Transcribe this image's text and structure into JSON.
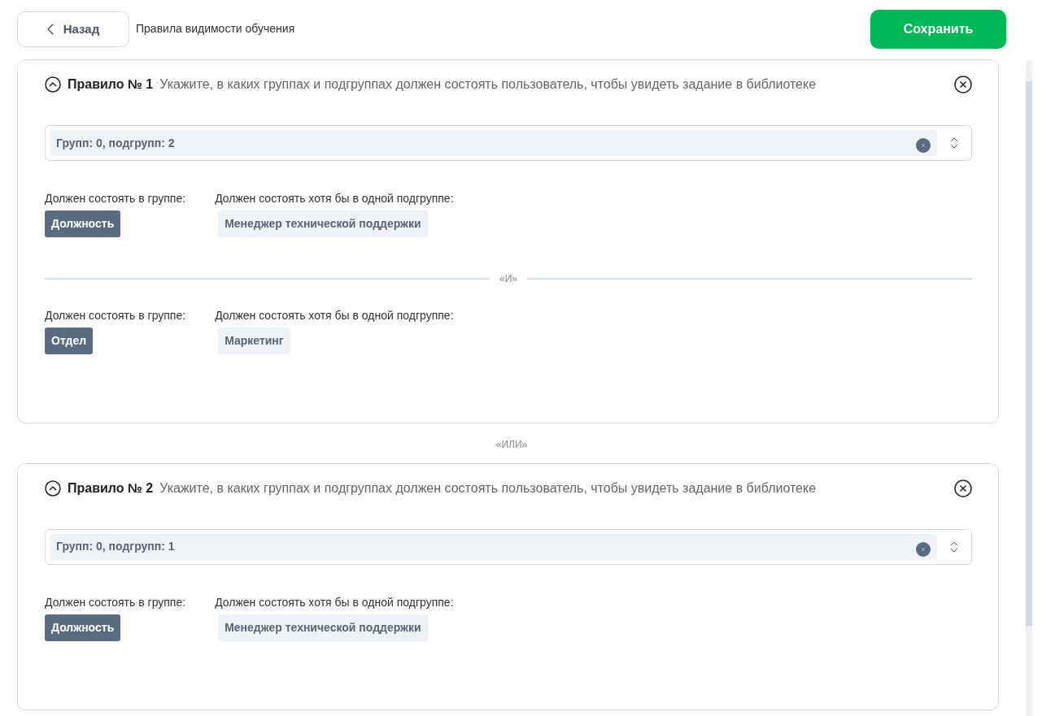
{
  "header": {
    "back_label": "Назад",
    "page_title": "Правила видимости обучения",
    "save_label": "Сохранить"
  },
  "rules": [
    {
      "expanded": true,
      "title": "Правило № 1",
      "hint": "Укажите, в каких группах и подгруппах должен состоять пользователь, чтобы увидеть задание в библиотеке",
      "select_value": "Групп: 0, подгрупп: 2",
      "conditions": [
        {
          "group_label": "Должен состоять в группе:",
          "group": "Должность",
          "subgroup_label": "Должен состоять хотя бы в одной подгруппе:",
          "subgroups": [
            "Менеджер технической поддержки"
          ]
        },
        {
          "separator": "«И»",
          "group_label": "Должен состоять в группе:",
          "group": "Отдел",
          "subgroup_label": "Должен состоять хотя бы в одной подгруппе:",
          "subgroups": [
            "Маркетинг"
          ]
        }
      ]
    },
    {
      "separator": "«ИЛИ»",
      "expanded": true,
      "title": "Правило № 2",
      "hint": "Укажите, в каких группах и подгруппах должен состоять пользователь, чтобы увидеть задание в библиотеке",
      "select_value": "Групп: 0, подгрупп: 1",
      "conditions": [
        {
          "group_label": "Должен состоять в группе:",
          "group": "Должность",
          "subgroup_label": "Должен состоять хотя бы в одной подгруппе:",
          "subgroups": [
            "Менеджер технической поддержки"
          ]
        }
      ]
    }
  ]
}
